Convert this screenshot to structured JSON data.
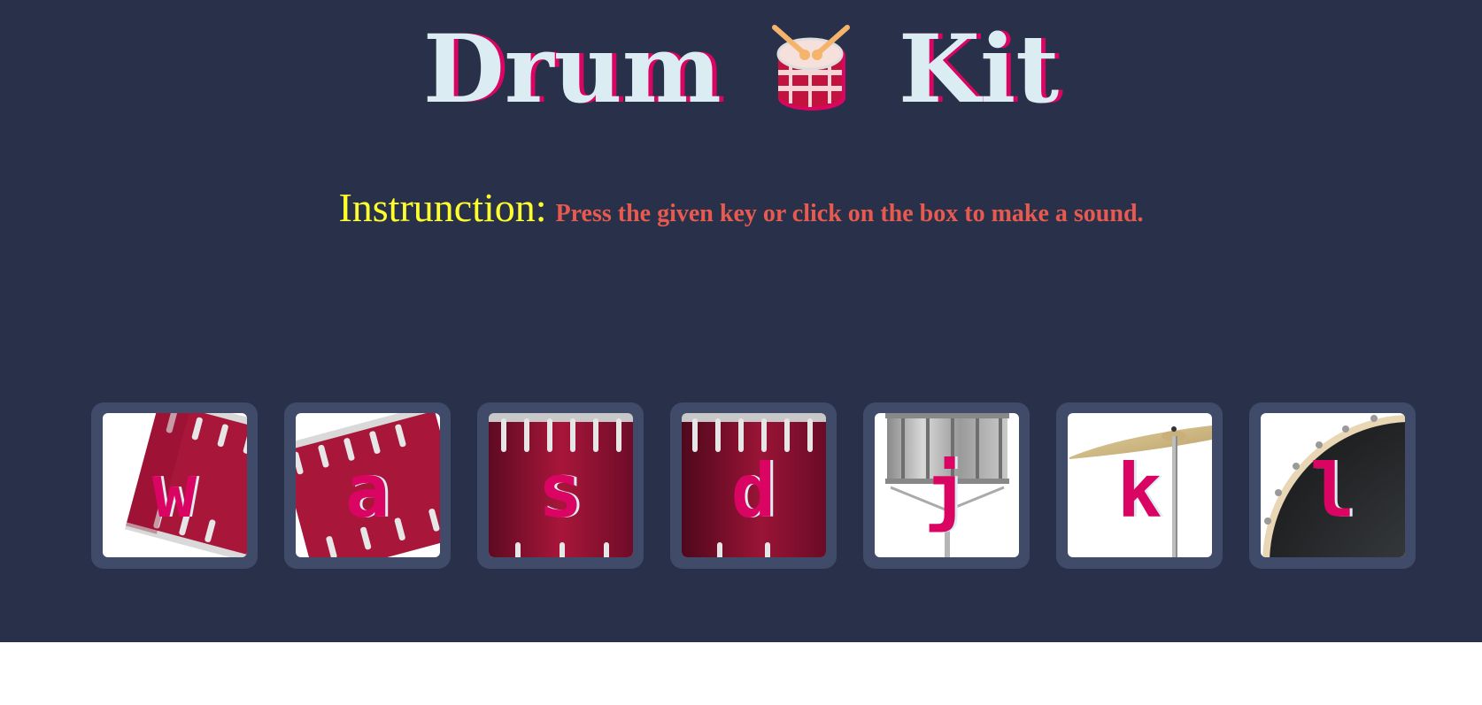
{
  "header": {
    "title_left": "Drum",
    "title_right": "Kit",
    "title_icon": "drum-icon"
  },
  "instruction": {
    "label": "Instrunction:",
    "text": "Press the given key or click on the box to make a sound."
  },
  "pads": [
    {
      "key": "w",
      "instrument": "tom-1"
    },
    {
      "key": "a",
      "instrument": "tom-2"
    },
    {
      "key": "s",
      "instrument": "tom-3"
    },
    {
      "key": "d",
      "instrument": "tom-4"
    },
    {
      "key": "j",
      "instrument": "snare"
    },
    {
      "key": "k",
      "instrument": "crash"
    },
    {
      "key": "l",
      "instrument": "kick"
    }
  ],
  "colors": {
    "background": "#283149",
    "pad_border": "#404B69",
    "title_text": "#DBEDF3",
    "accent": "#DA0463",
    "instruction_label": "#FFFF2E",
    "instruction_text": "#E85A4F"
  }
}
